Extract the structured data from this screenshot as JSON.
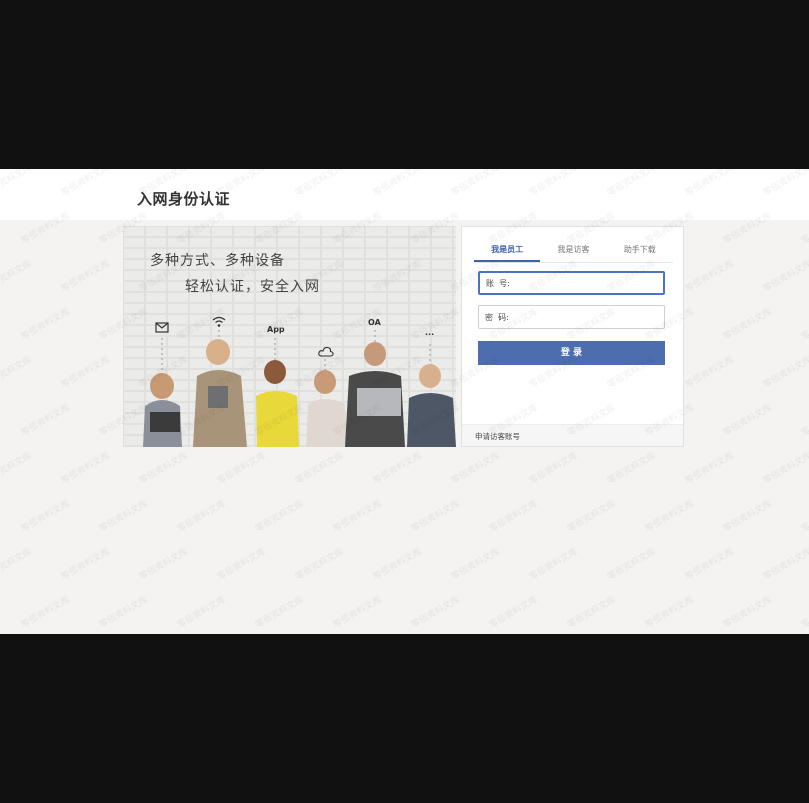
{
  "page": {
    "title": "入网身份认证"
  },
  "hero": {
    "slogan_line1": "多种方式、多种设备",
    "slogan_line2": "轻松认证，安全入网",
    "device_labels": {
      "app": "App",
      "oa": "OA",
      "more": "···"
    },
    "icons": [
      "mail-icon",
      "wifi-icon",
      "cloud-icon"
    ]
  },
  "login": {
    "tabs": [
      {
        "label": "我是员工",
        "active": true
      },
      {
        "label": "我是访客",
        "active": false
      },
      {
        "label": "助手下载",
        "active": false
      }
    ],
    "account_label": "账  号:",
    "password_label": "密  码:",
    "submit_label": "登 录",
    "footer_link": "申请访客账号"
  },
  "watermark": "零佰资料文库",
  "colors": {
    "accent": "#4d6eae",
    "background": "#f4f3f1",
    "letterbox": "#111111"
  }
}
